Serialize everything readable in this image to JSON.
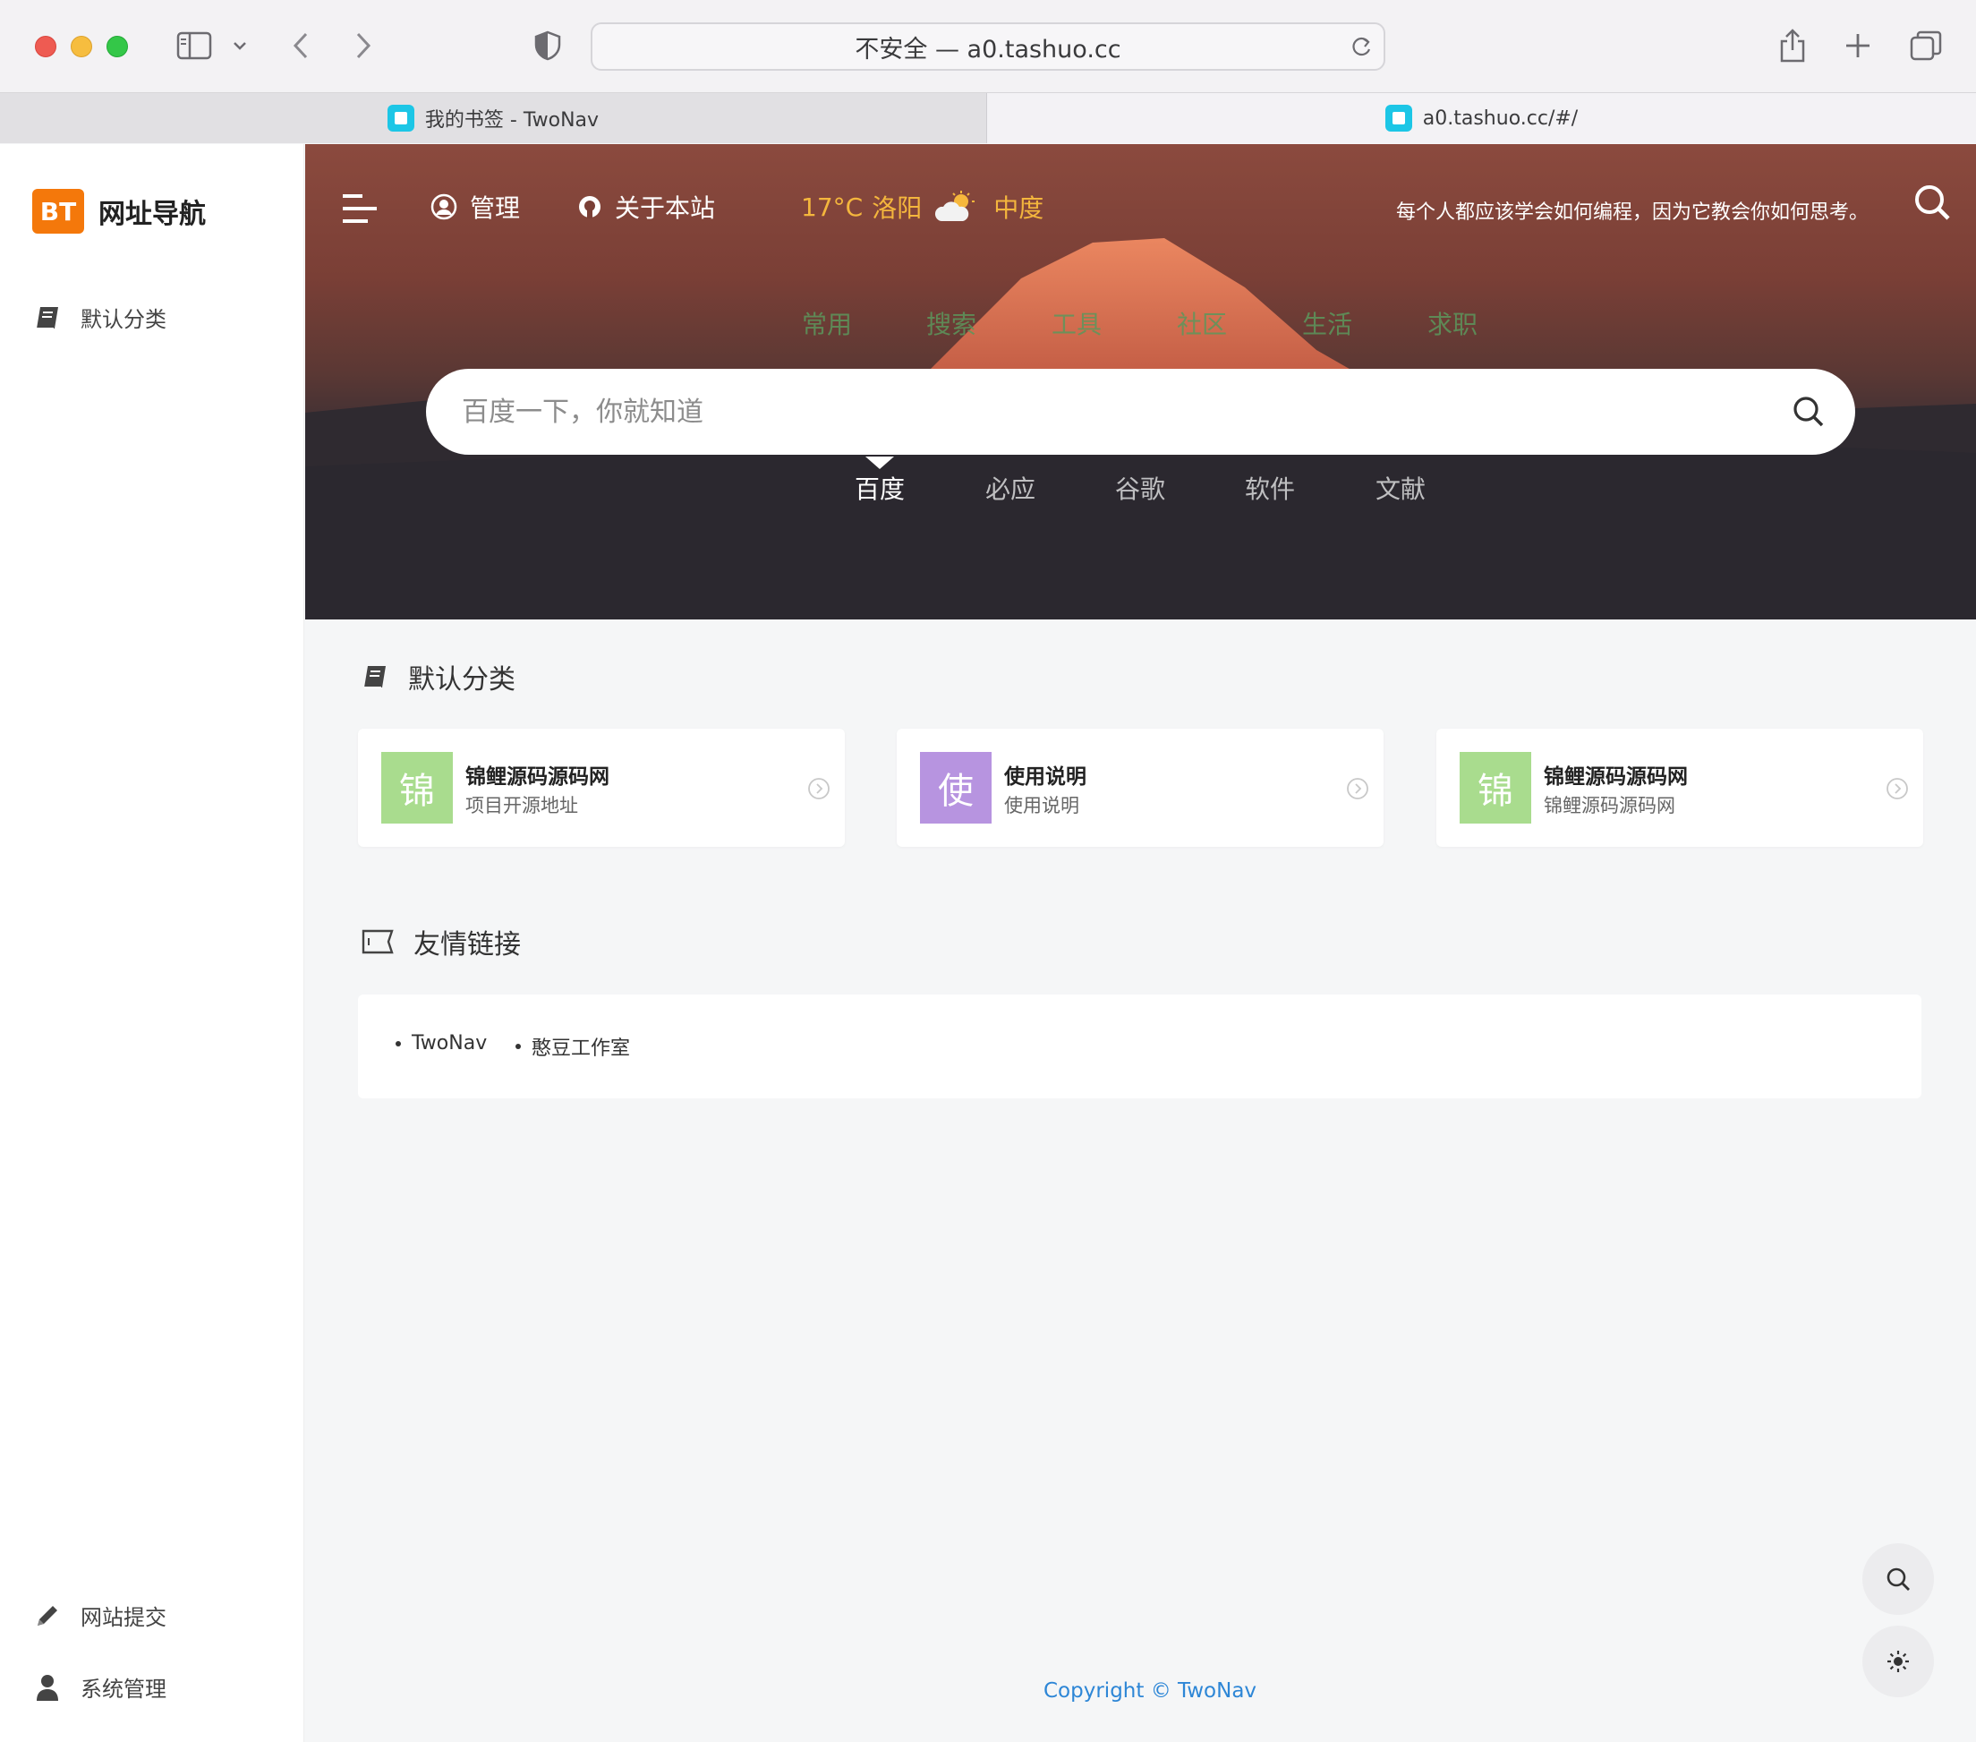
{
  "browser": {
    "address": "不安全 — a0.tashuo.cc",
    "tabs": [
      {
        "label": "我的书签 - TwoNav"
      },
      {
        "label": "a0.tashuo.cc/#/"
      }
    ]
  },
  "sidebar": {
    "brand_logo": "BT",
    "brand_name": "网址导航",
    "items": [
      {
        "label": "默认分类"
      }
    ],
    "bottom": [
      {
        "label": "网站提交"
      },
      {
        "label": "系统管理"
      }
    ]
  },
  "hero": {
    "nav": {
      "manage": "管理",
      "about": "关于本站",
      "weather_temp": "17°C",
      "weather_city": "洛阳",
      "weather_air": "中度"
    },
    "motto": "每个人都应该学会如何编程，因为它教会你如何思考。",
    "categories": [
      "常用",
      "搜索",
      "工具",
      "社区",
      "生活",
      "求职"
    ],
    "search_placeholder": "百度一下，你就知道",
    "engines": [
      "百度",
      "必应",
      "谷歌",
      "软件",
      "文献"
    ]
  },
  "main": {
    "section_title": "默认分类",
    "cards": [
      {
        "thumb": "锦",
        "title": "锦鲤源码源码网",
        "desc": "项目开源地址",
        "color": "#a9dc8e"
      },
      {
        "thumb": "使",
        "title": "使用说明",
        "desc": "使用说明",
        "color": "#b794e0"
      },
      {
        "thumb": "锦",
        "title": "锦鲤源码源码网",
        "desc": "锦鲤源码源码网",
        "color": "#a9dc8e"
      }
    ],
    "links_title": "友情链接",
    "links": [
      "TwoNav",
      "憨豆工作室"
    ]
  },
  "footer": "Copyright © TwoNav"
}
